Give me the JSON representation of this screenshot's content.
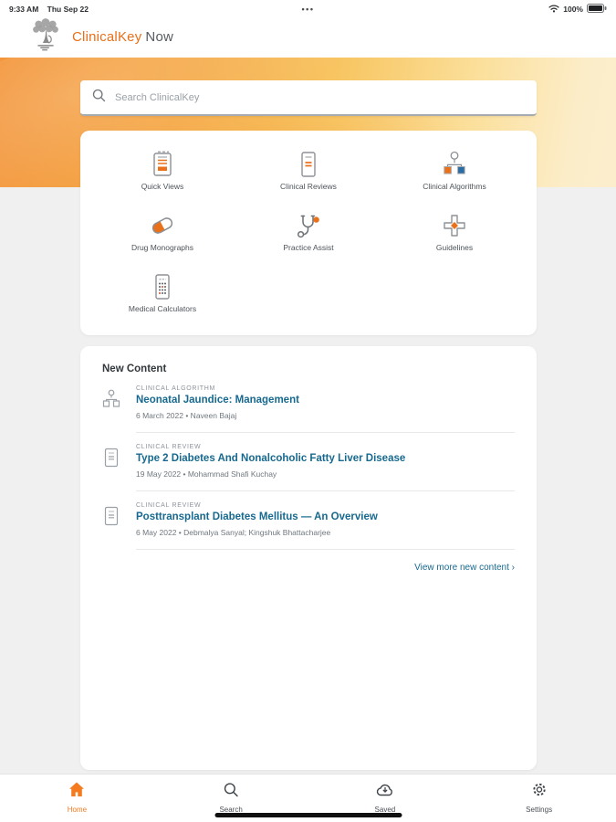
{
  "status_bar": {
    "time": "9:33 AM",
    "date": "Thu Sep 22",
    "ellipsis": "•••",
    "battery_percent": "100%"
  },
  "header": {
    "brand": "ClinicalKey",
    "brand_suffix": "Now",
    "logo": "elsevier-tree-logo"
  },
  "search": {
    "placeholder": "Search ClinicalKey"
  },
  "quick_links": [
    {
      "label": "Quick Views",
      "icon": "quick-views-icon"
    },
    {
      "label": "Clinical Reviews",
      "icon": "clinical-reviews-icon"
    },
    {
      "label": "Clinical Algorithms",
      "icon": "clinical-algorithms-icon"
    },
    {
      "label": "Drug Monographs",
      "icon": "drug-monographs-icon"
    },
    {
      "label": "Practice Assist",
      "icon": "practice-assist-icon"
    },
    {
      "label": "Guidelines",
      "icon": "guidelines-icon"
    },
    {
      "label": "Medical Calculators",
      "icon": "medical-calculators-icon"
    }
  ],
  "new_content": {
    "title": "New Content",
    "items": [
      {
        "category": "CLINICAL ALGORITHM",
        "title": "Neonatal Jaundice: Management",
        "meta": "6 March 2022 • Naveen Bajaj",
        "icon": "algorithm-icon"
      },
      {
        "category": "CLINICAL REVIEW",
        "title": "Type 2 Diabetes And Nonalcoholic Fatty Liver Disease",
        "meta": "19 May 2022 • Mohammad Shafi Kuchay",
        "icon": "review-icon"
      },
      {
        "category": "CLINICAL REVIEW",
        "title": "Posttransplant Diabetes Mellitus — An Overview",
        "meta": "6 May 2022 • Debmalya Sanyal; Kingshuk Bhattacharjee",
        "icon": "review-icon"
      }
    ],
    "view_more": "View more new content ›"
  },
  "tab_bar": [
    {
      "label": "Home",
      "active": true
    },
    {
      "label": "Search",
      "active": false
    },
    {
      "label": "Saved",
      "active": false
    },
    {
      "label": "Settings",
      "active": false
    }
  ],
  "colors": {
    "brand_orange": "#E8701A",
    "accent_orange": "#F47B20",
    "icon_orange": "#E9711C",
    "algorithm_blue": "#2B6CA3",
    "link_blue": "#17698F",
    "banner_gradient_start": "#F3953A",
    "banner_gradient_end": "#FCEECD",
    "background_gray": "#F0F0F1"
  }
}
